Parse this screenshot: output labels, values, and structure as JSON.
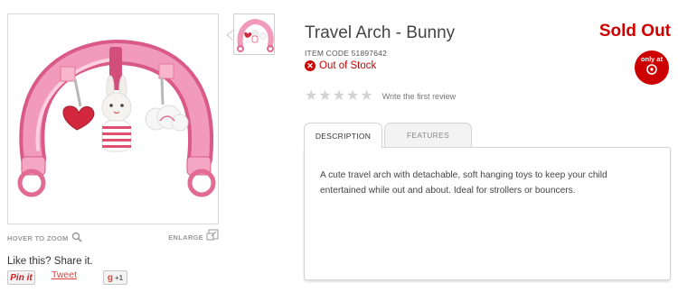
{
  "product": {
    "title": "Travel Arch - Bunny",
    "item_code": "ITEM CODE 51897642",
    "stock_status": "Out of Stock",
    "sold_out": "Sold Out",
    "badge": {
      "line1": "only at",
      "icon": "target-bullseye-icon"
    }
  },
  "rating": {
    "stars_filled": 0,
    "stars_total": 5,
    "review_link": "Write the first review"
  },
  "gallery": {
    "hover_zoom": "HOVER TO ZOOM",
    "enlarge": "ENLARGE"
  },
  "share": {
    "title": "Like this? Share it.",
    "pinit": "Pin it",
    "tweet": "Tweet",
    "gplus_count": "+1"
  },
  "tabs": [
    {
      "label": "DESCRIPTION",
      "active": true
    },
    {
      "label": "FEATURES",
      "active": false
    }
  ],
  "description": "A cute travel arch with detachable, soft hanging toys to keep your child entertained while out and about. Ideal for strollers or bouncers.",
  "colors": {
    "brand_red": "#cc0000",
    "arch_pink": "#f07aa0"
  }
}
